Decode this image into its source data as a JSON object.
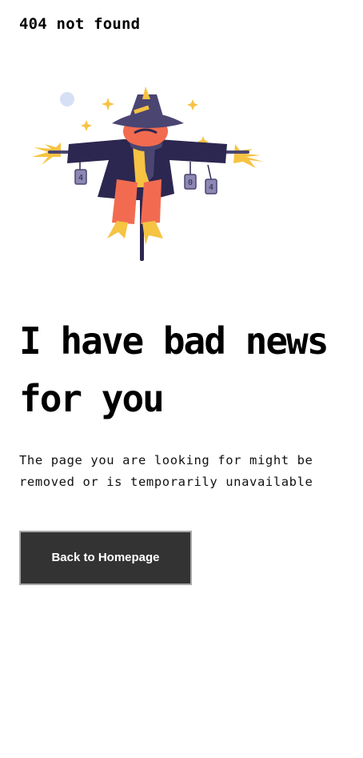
{
  "page": {
    "top_label": "404 not found",
    "headline": "I have bad news for you",
    "message": "The page you are looking for might be removed or is temporarily unavailable",
    "button_label": "Back to Homepage"
  },
  "illustration": {
    "can_labels": [
      "4",
      "0",
      "4"
    ],
    "colors": {
      "navy": "#2c2750",
      "purple": "#4a4571",
      "orange": "#f26b50",
      "yellow": "#f6c343",
      "sky": "#d6e0f5",
      "button_bg": "#333333",
      "button_border": "#a8a8a8"
    }
  }
}
